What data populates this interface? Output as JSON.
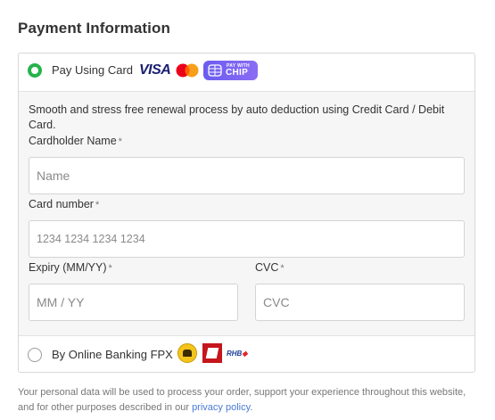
{
  "title": "Payment Information",
  "card_option": {
    "label": "Pay Using Card",
    "visa_text": "VISA",
    "chip_small": "PAY WITH",
    "chip_big": "CHIP",
    "description": "Smooth and stress free renewal process by auto deduction using Credit Card / Debit Card.",
    "cardholder": {
      "label": "Cardholder Name",
      "required": "*",
      "placeholder": "Name"
    },
    "card_number": {
      "label": "Card number",
      "required": "*",
      "placeholder": "1234 1234 1234 1234"
    },
    "expiry": {
      "label": "Expiry (MM/YY)",
      "required": "*",
      "placeholder": "MM / YY"
    },
    "cvc": {
      "label": "CVC",
      "required": "*",
      "placeholder": "CVC"
    }
  },
  "fpx_option": {
    "label": "By Online Banking FPX",
    "rhb_text": "RHB",
    "rhb_mark": "◆"
  },
  "footer": {
    "text": "Your personal data will be used to process your order, support your experience throughout this website, and for other purposes described in our ",
    "link": "privacy policy",
    "end": "."
  },
  "colors": {
    "selected_radio": "#26b34a",
    "link": "#4a7ad8",
    "chip_gradient": "#6b5cf0"
  }
}
